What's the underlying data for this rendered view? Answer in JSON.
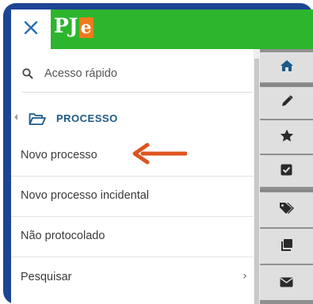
{
  "header": {
    "logo_main": "PJ",
    "logo_accent": "e",
    "close_icon": "close-icon"
  },
  "search": {
    "placeholder": "Acesso rápido",
    "icon": "search-icon"
  },
  "section": {
    "label": "PROCESSO",
    "icon": "folder-open-icon"
  },
  "menu": {
    "items": [
      {
        "label": "Novo processo"
      },
      {
        "label": "Novo processo incidental"
      },
      {
        "label": "Não protocolado"
      },
      {
        "label": "Pesquisar",
        "chevron": "›"
      }
    ]
  },
  "rail": {
    "icons": [
      "home-icon",
      "pencil-icon",
      "star-icon",
      "checkbox-icon",
      "tags-icon",
      "copy-icon",
      "envelope-icon"
    ]
  },
  "colors": {
    "header_green": "#2db52d",
    "logo_accent": "#f07a1a",
    "frame_blue": "#1c4594",
    "section_blue": "#1d5a85",
    "arrow_orange": "#e0541e",
    "rail_gray": "#8f8f8f"
  }
}
